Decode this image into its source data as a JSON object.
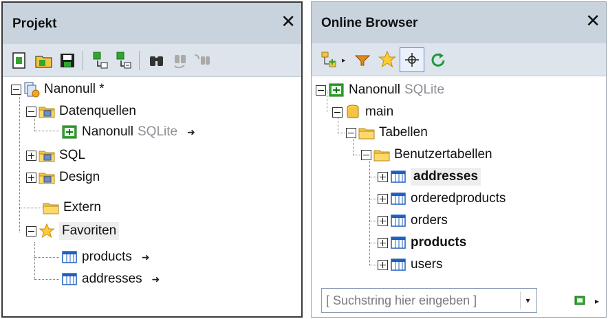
{
  "projekt_panel": {
    "title": "Projekt",
    "close": "✕",
    "tree": {
      "root": {
        "label": "Nanonull *"
      },
      "datenquellen": {
        "label": "Datenquellen"
      },
      "nanonull_conn": {
        "label": "Nanonull",
        "sub": "SQLite",
        "arrow": "➜"
      },
      "sql": {
        "label": "SQL"
      },
      "design": {
        "label": "Design"
      },
      "extern": {
        "label": "Extern"
      },
      "favoriten": {
        "label": "Favoriten"
      },
      "products": {
        "label": "products",
        "arrow": "➜"
      },
      "addresses": {
        "label": "addresses",
        "arrow": "➜"
      }
    }
  },
  "browser_panel": {
    "title": "Online Browser",
    "close": "✕",
    "tree": {
      "root": {
        "label": "Nanonull",
        "sub": "SQLite"
      },
      "main": {
        "label": "main"
      },
      "tabellen": {
        "label": "Tabellen"
      },
      "benutzertabellen": {
        "label": "Benutzertabellen"
      },
      "tables": [
        {
          "label": "addresses",
          "bold": true,
          "highlighted": true
        },
        {
          "label": "orderedproducts",
          "bold": false
        },
        {
          "label": "orders",
          "bold": false
        },
        {
          "label": "products",
          "bold": true
        },
        {
          "label": "users",
          "bold": false
        }
      ]
    },
    "search": {
      "placeholder": "[ Suchstring hier eingeben ]",
      "value": ""
    },
    "dropdown_glyph": "▾",
    "more_glyph": "▸"
  },
  "icons": {
    "toolbar_left": [
      "new-project-icon",
      "open-project-icon",
      "save-project-icon",
      "add-to-project-icon",
      "remove-from-project-icon",
      "find-icon",
      "find-next-icon",
      "replace-icon"
    ],
    "toolbar_right": [
      "add-object-icon",
      "filter-icon",
      "favorites-icon",
      "locate-icon",
      "refresh-icon"
    ]
  },
  "colors": {
    "titlebar": "#c9d3de",
    "toolbar": "#dde4ec",
    "folder": "#f5c542",
    "sqlite_green": "#2fa62f",
    "table_blue": "#1f5fbf"
  }
}
